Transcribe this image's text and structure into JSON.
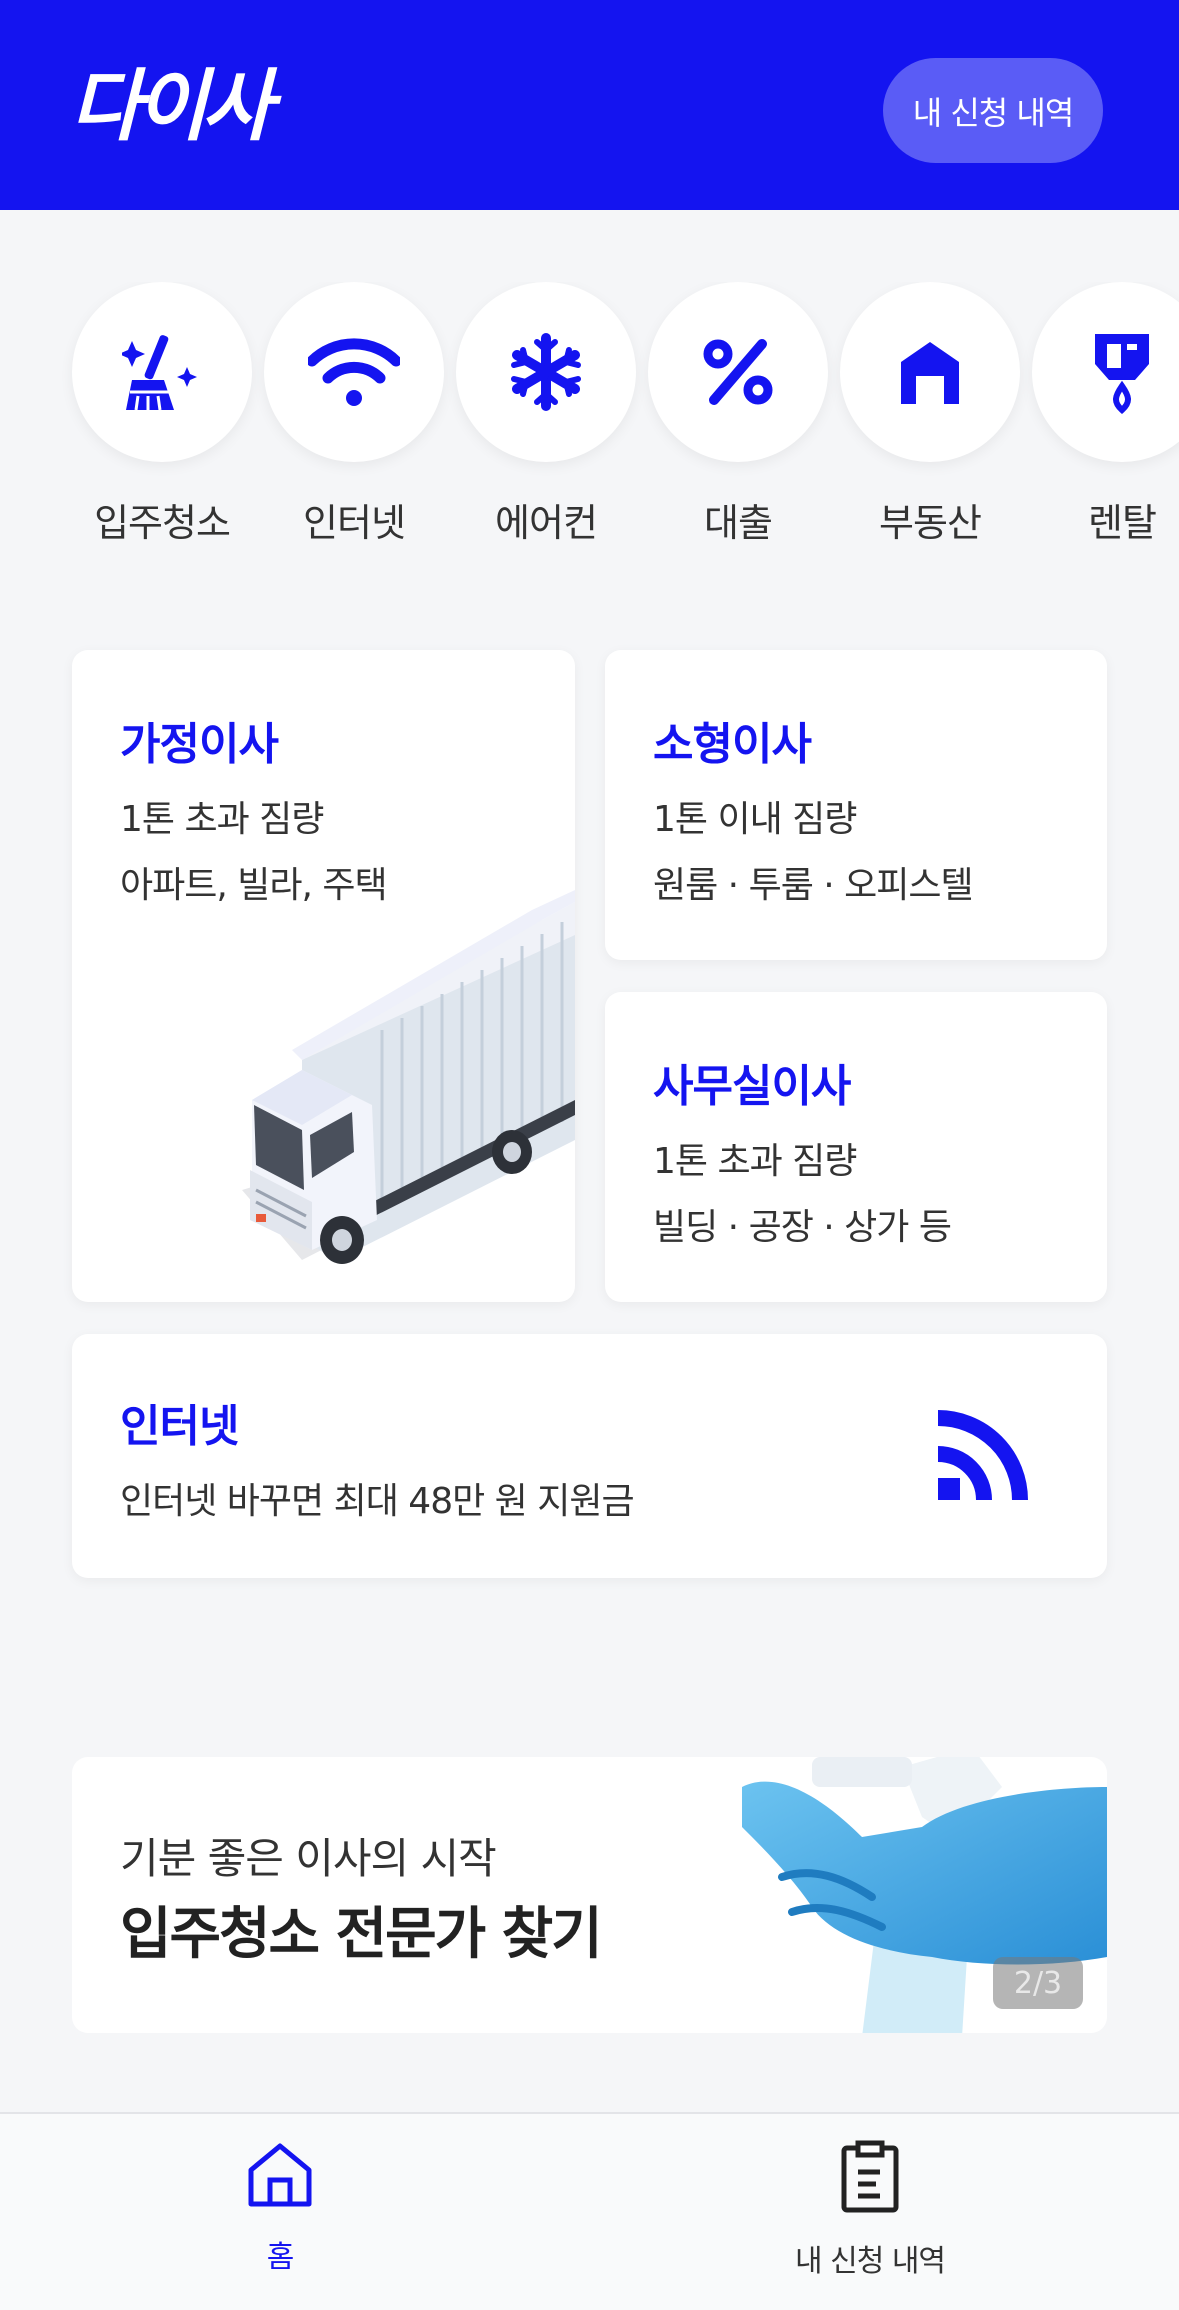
{
  "header": {
    "logo": "다이사",
    "my_requests_button": "내 신청 내역"
  },
  "categories": [
    {
      "label": "입주청소",
      "icon": "cleaning-broom-icon"
    },
    {
      "label": "인터넷",
      "icon": "wifi-icon"
    },
    {
      "label": "에어컨",
      "icon": "snowflake-icon"
    },
    {
      "label": "대출",
      "icon": "percent-icon"
    },
    {
      "label": "부동산",
      "icon": "house-icon"
    },
    {
      "label": "렌탈",
      "icon": "water-purifier-icon"
    }
  ],
  "cards": {
    "home_move": {
      "title": "가정이사",
      "line1": "1톤 초과 짐량",
      "line2": "아파트, 빌라, 주택"
    },
    "small_move": {
      "title": "소형이사",
      "line1": "1톤 이내 짐량",
      "line2": "원룸 · 투룸 · 오피스텔"
    },
    "office_move": {
      "title": "사무실이사",
      "line1": "1톤 초과 짐량",
      "line2": "빌딩 · 공장 · 상가 등"
    },
    "internet": {
      "title": "인터넷",
      "line1": "인터넷 바꾸면 최대 48만 원 지원금"
    }
  },
  "banner": {
    "subtitle": "기분 좋은 이사의 시작",
    "title": "입주청소 전문가 찾기",
    "pager": "2/3"
  },
  "bottom_nav": {
    "home": "홈",
    "my_requests": "내 신청 내역"
  },
  "colors": {
    "brand": "#1414f0",
    "header_button": "#5a5cf6",
    "background": "#f5f6f8"
  }
}
